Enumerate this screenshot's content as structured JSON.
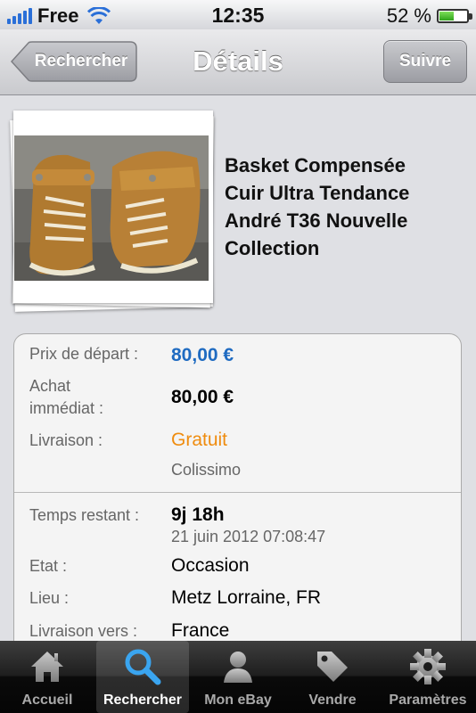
{
  "status_bar": {
    "carrier": "Free",
    "time": "12:35",
    "battery": "52 %",
    "battery_level": 0.52
  },
  "nav": {
    "back_label": "Rechercher",
    "title": "Détails",
    "follow_label": "Suivre"
  },
  "item": {
    "title_lines": [
      "Basket Compensée",
      "Cuir Ultra Tendance",
      "André T36 Nouvelle",
      "Collection"
    ],
    "image_icon": "sneaker-photo"
  },
  "details": {
    "start_price_label": "Prix de départ :",
    "start_price": "80,00 €",
    "buy_now_label_1": "Achat",
    "buy_now_label_2": "immédiat :",
    "buy_now_price": "80,00 €",
    "shipping_label": "Livraison :",
    "shipping_value": "Gratuit",
    "shipping_method": "Colissimo",
    "time_left_label": "Temps restant :",
    "time_left": "9j 18h",
    "end_date": "21 juin 2012 07:08:47",
    "condition_label": "Etat :",
    "condition": "Occasion",
    "location_label": "Lieu :",
    "location": "Metz Lorraine, FR",
    "ships_to_label": "Livraison vers :",
    "ships_to": "France"
  },
  "tabs": [
    {
      "label": "Accueil",
      "icon": "home-icon",
      "active": false
    },
    {
      "label": "Rechercher",
      "icon": "search-icon",
      "active": true
    },
    {
      "label": "Mon eBay",
      "icon": "person-icon",
      "active": false
    },
    {
      "label": "Vendre",
      "icon": "tag-icon",
      "active": false
    },
    {
      "label": "Paramètres",
      "icon": "gear-icon",
      "active": false
    }
  ],
  "colors": {
    "accent_blue": "#1f6bc1",
    "free_orange": "#ef8c0f",
    "signal_blue": "#2a6fd8"
  }
}
